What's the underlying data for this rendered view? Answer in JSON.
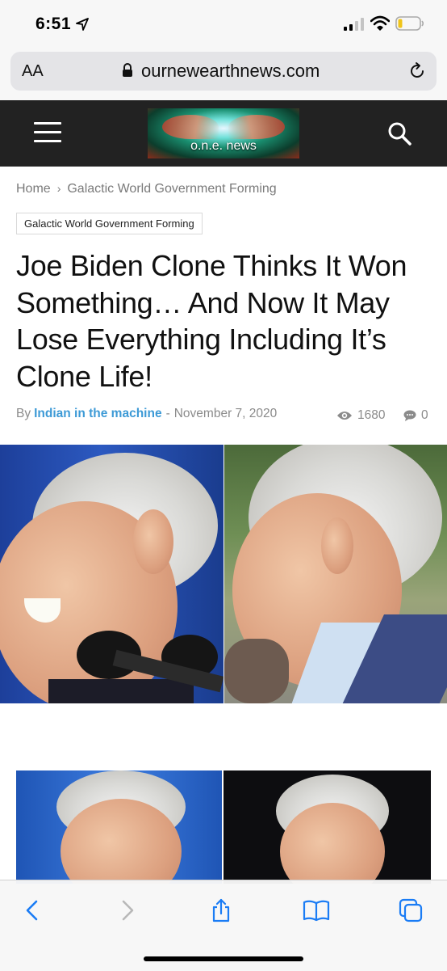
{
  "status_bar": {
    "time": "6:51",
    "icons": [
      "location-arrow-icon",
      "cellular-signal-icon",
      "wifi-icon",
      "battery-icon"
    ]
  },
  "address_bar": {
    "text_size_label": "AA",
    "url": "ournewearthnews.com",
    "icons": [
      "lock-icon",
      "reload-icon"
    ]
  },
  "site_header": {
    "logo_text": "o.n.e. news",
    "icons": [
      "hamburger-menu-icon",
      "search-icon"
    ]
  },
  "breadcrumb": {
    "home": "Home",
    "separator": "›",
    "current": "Galactic World Government Forming"
  },
  "article": {
    "category_tag": "Galactic World Government Forming",
    "title": "Joe Biden Clone Thinks It Won Something… And Now It May Lose Everything Including It’s Clone Life!",
    "meta": {
      "by_label": "By",
      "author": "Indian in the machine",
      "dash": "-",
      "date": "November 7, 2020",
      "views": "1680",
      "comments": "0"
    }
  },
  "toolbar": {
    "icons": [
      "back-icon",
      "forward-icon",
      "share-icon",
      "bookmarks-icon",
      "tabs-icon"
    ]
  },
  "colors": {
    "site_header_bg": "#222222",
    "author_link": "#3d9ad6",
    "toolbar_icon": "#1a7cf5"
  }
}
